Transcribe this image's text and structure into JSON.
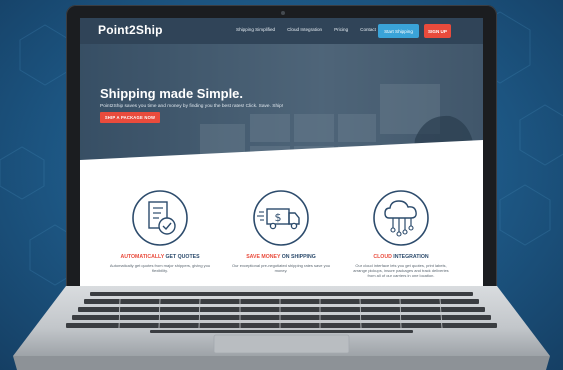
{
  "site": {
    "brand_part1": "Point",
    "brand_part2": "2",
    "brand_part3": "Ship"
  },
  "nav": {
    "links": [
      "Shipping Simplified",
      "Cloud Integration",
      "Pricing",
      "Contact"
    ],
    "start_label": "Start Shipping",
    "signup_label": "SIGN UP"
  },
  "hero": {
    "title": "Shipping made Simple.",
    "subtitle": "Point2Ship saves you time and money by finding you the best rates! Click. Save. Ship!",
    "cta_label": "SHIP A PACKAGE NOW"
  },
  "features": [
    {
      "icon": "document-check-icon",
      "title_highlight": "AUTOMATICALLY",
      "title_rest": " GET QUOTES",
      "desc": "Automatically get quotes from major shippers, giving you flexibility."
    },
    {
      "icon": "truck-dollar-icon",
      "title_highlight": "SAVE MONEY",
      "title_rest": " ON SHIPPING",
      "desc": "Our exceptional pre-negotiated shipping rates save you money."
    },
    {
      "icon": "cloud-network-icon",
      "title_highlight": "CLOUD",
      "title_rest": " INTEGRATION",
      "desc": "Our cloud interface lets you get quotes, print labels, arrange pickups, insure packages and track deliveries from all of our carriers in one location."
    }
  ],
  "colors": {
    "accent_red": "#e94b3c",
    "accent_blue": "#3aa3d8",
    "nav_bg": "#1e344a",
    "icon_blue": "#2c4b6c",
    "background": "#1d5784"
  }
}
